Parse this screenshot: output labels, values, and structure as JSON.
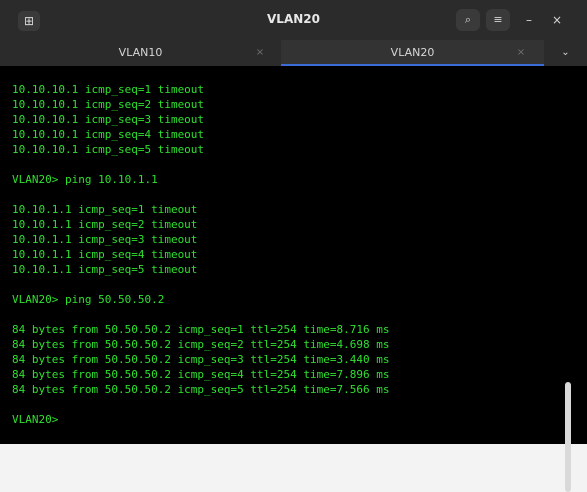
{
  "window": {
    "title": "VLAN20"
  },
  "toolbar": {
    "new_tab_icon": "new-tab-icon",
    "search_icon": "search-icon",
    "menu_icon": "hamburger-menu-icon",
    "minimize_label": "–",
    "close_label": "×"
  },
  "tabs": [
    {
      "label": "VLAN10",
      "close": "×"
    },
    {
      "label": "VLAN20",
      "close": "×"
    }
  ],
  "tabs_menu_label": "⌄",
  "terminal_lines": [
    "10.10.10.1 icmp_seq=1 timeout",
    "10.10.10.1 icmp_seq=2 timeout",
    "10.10.10.1 icmp_seq=3 timeout",
    "10.10.10.1 icmp_seq=4 timeout",
    "10.10.10.1 icmp_seq=5 timeout",
    "",
    "VLAN20> ping 10.10.1.1",
    "",
    "10.10.1.1 icmp_seq=1 timeout",
    "10.10.1.1 icmp_seq=2 timeout",
    "10.10.1.1 icmp_seq=3 timeout",
    "10.10.1.1 icmp_seq=4 timeout",
    "10.10.1.1 icmp_seq=5 timeout",
    "",
    "VLAN20> ping 50.50.50.2",
    "",
    "84 bytes from 50.50.50.2 icmp_seq=1 ttl=254 time=8.716 ms",
    "84 bytes from 50.50.50.2 icmp_seq=2 ttl=254 time=4.698 ms",
    "84 bytes from 50.50.50.2 icmp_seq=3 ttl=254 time=3.440 ms",
    "84 bytes from 50.50.50.2 icmp_seq=4 ttl=254 time=7.896 ms",
    "84 bytes from 50.50.50.2 icmp_seq=5 ttl=254 time=7.566 ms",
    "",
    "VLAN20>"
  ],
  "colors": {
    "terminal_text": "#2fe02f",
    "terminal_bg": "#000000",
    "titlebar": "#2b2b2b",
    "active_tab_underline": "#3a6bd6"
  }
}
